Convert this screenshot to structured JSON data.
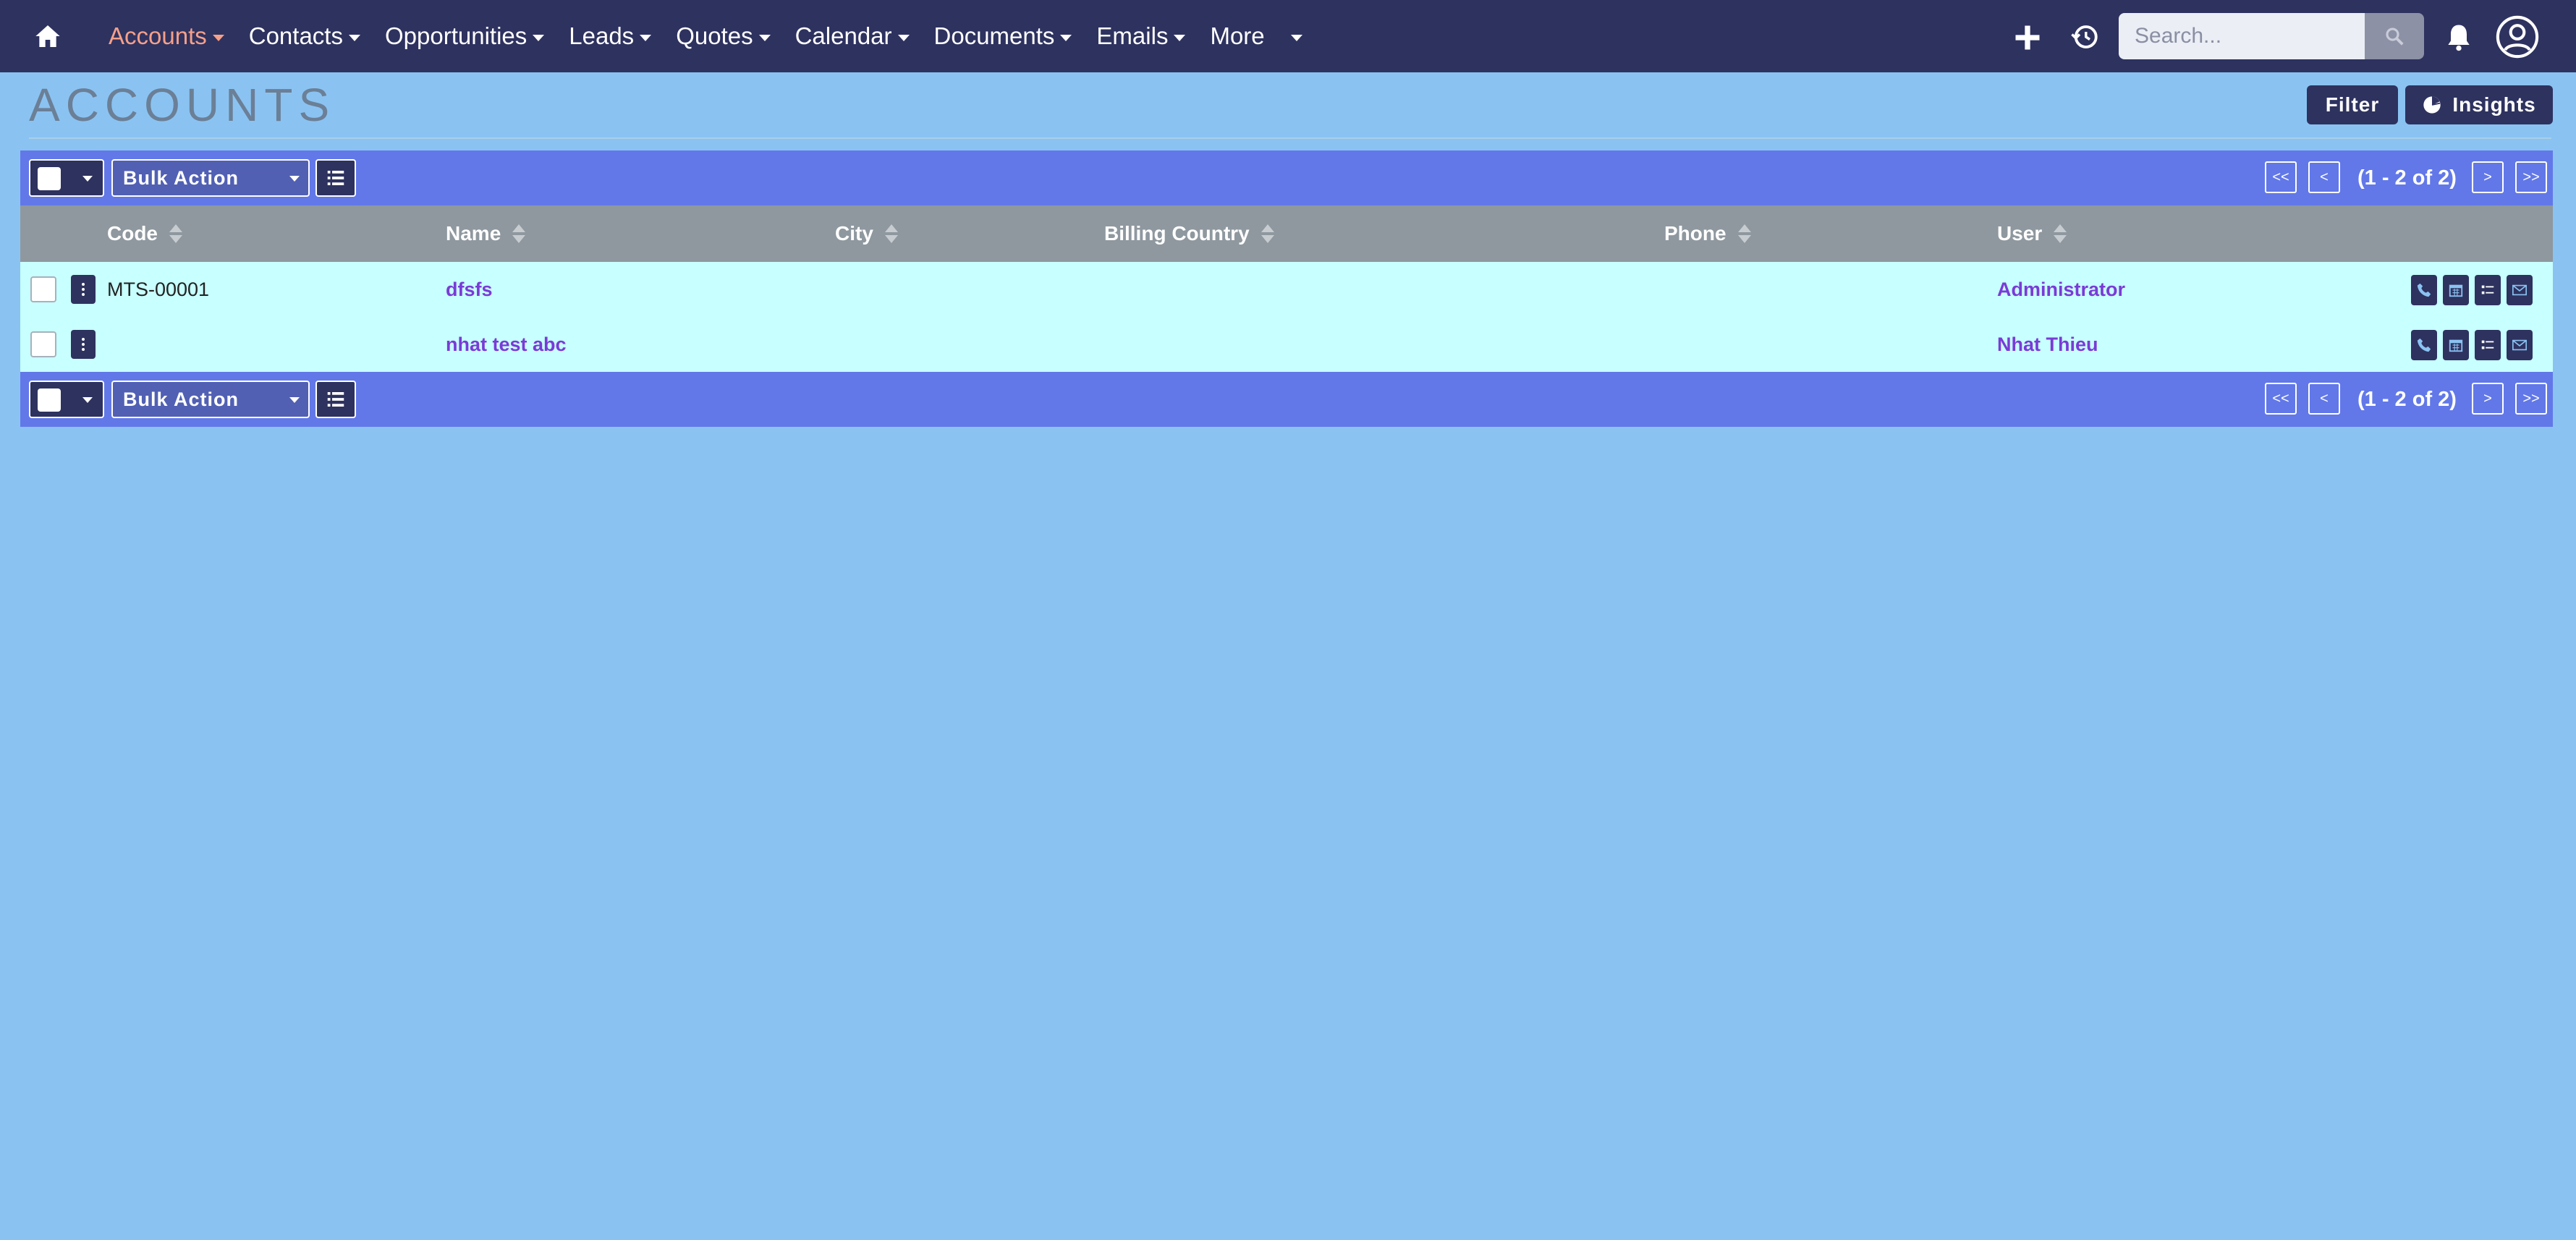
{
  "nav": {
    "items": [
      {
        "label": "Accounts",
        "active": true
      },
      {
        "label": "Contacts"
      },
      {
        "label": "Opportunities"
      },
      {
        "label": "Leads"
      },
      {
        "label": "Quotes"
      },
      {
        "label": "Calendar"
      },
      {
        "label": "Documents"
      },
      {
        "label": "Emails"
      },
      {
        "label": "More"
      }
    ],
    "search_placeholder": "Search...",
    "icons": [
      "home-icon",
      "plus-icon",
      "history-icon",
      "search-icon",
      "bell-icon",
      "user-icon"
    ]
  },
  "page": {
    "title": "ACCOUNTS",
    "filter_label": "Filter",
    "insights_label": "Insights"
  },
  "actionbar": {
    "bulk_action_label": "Bulk Action",
    "first_label": "<<",
    "prev_label": "<",
    "next_label": ">",
    "last_label": ">>",
    "count_text": "(1 - 2 of 2)"
  },
  "table": {
    "columns": [
      "Code",
      "Name",
      "City",
      "Billing Country",
      "Phone",
      "User"
    ],
    "rows": [
      {
        "code": "MTS-00001",
        "name": "dfsfs",
        "city": "",
        "billing_country": "",
        "phone": "",
        "user": "Administrator"
      },
      {
        "code": "",
        "name": "nhat test abc",
        "city": "",
        "billing_country": "",
        "phone": "",
        "user": "Nhat Thieu"
      }
    ],
    "row_action_icons": [
      "phone-icon",
      "calendar-icon",
      "task-list-icon",
      "email-icon"
    ]
  },
  "colors": {
    "nav_bg": "#2e325f",
    "page_bg": "#8ac3f2",
    "active_nav": "#f5a08a",
    "actionbar_bg": "#6278e8",
    "header_bg": "#8f989f",
    "row_bg": "#c8ffff",
    "link": "#7a3bd6"
  }
}
